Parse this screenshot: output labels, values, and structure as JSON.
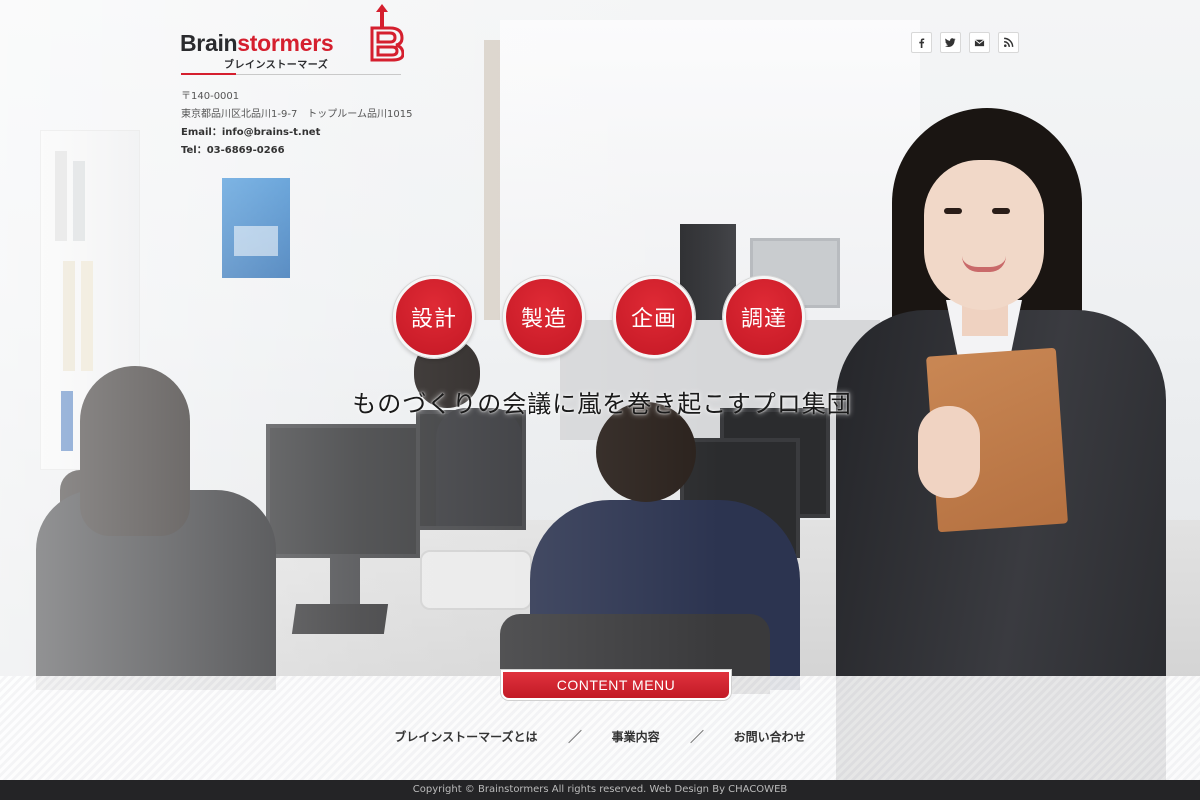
{
  "brand": {
    "name_dark": "Brain",
    "name_red": "stormers",
    "subtitle": "ブレインストーマーズ",
    "red": "#d51f2e"
  },
  "contact": {
    "postal": "〒140-0001",
    "address": "東京都品川区北品川1-9-7　トップルーム品川1015",
    "email": "Email：info@brains-t.net",
    "tel": "Tel：03-6869-0266"
  },
  "social": [
    {
      "icon": "facebook-icon"
    },
    {
      "icon": "twitter-icon"
    },
    {
      "icon": "mail-icon"
    },
    {
      "icon": "rss-icon"
    }
  ],
  "services": [
    "設計",
    "製造",
    "企画",
    "調達"
  ],
  "tagline": "ものづくりの会議に嵐を巻き起こすプロ集団",
  "content_menu": {
    "title": "CONTENT MENU",
    "items": [
      "ブレインストーマーズとは",
      "事業内容",
      "お問い合わせ"
    ]
  },
  "footer": {
    "copyright": "Copyright © Brainstormers  All rights reserved.  Web Design By CHACOWEB"
  }
}
